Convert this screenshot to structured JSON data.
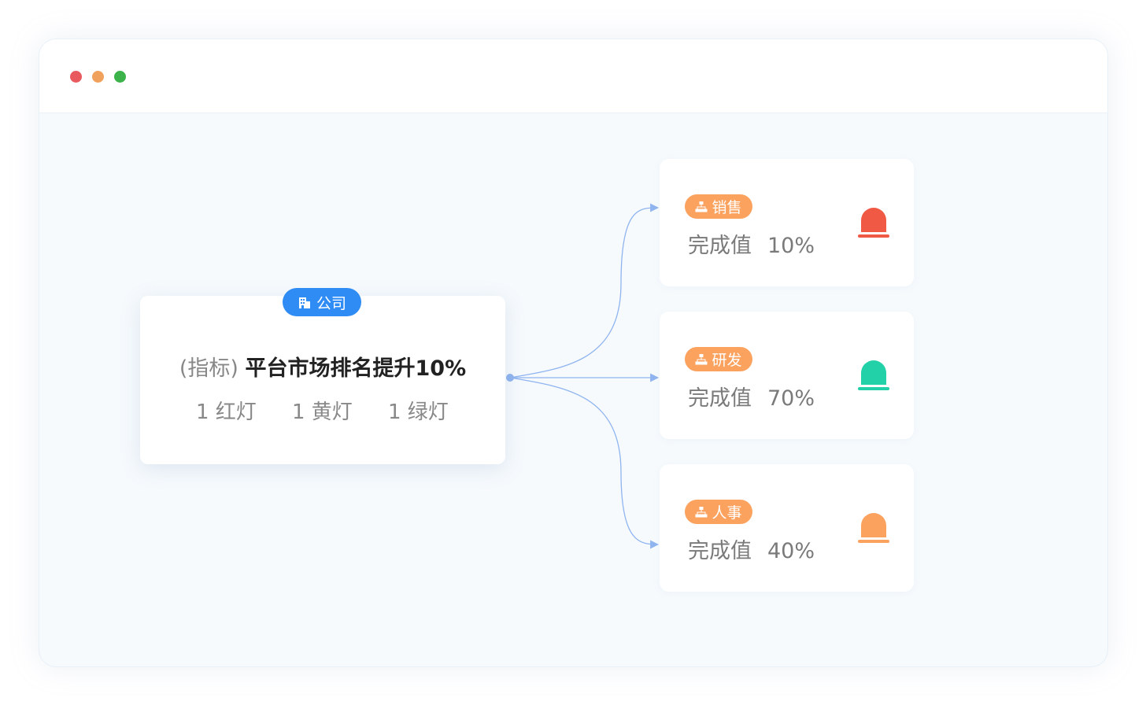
{
  "window": {
    "controls": [
      "close-dot",
      "minimize-dot",
      "maximize-dot"
    ],
    "colors": {
      "close": "#e95a5f",
      "minimize": "#f0a15c",
      "maximize": "#3bb34a"
    }
  },
  "diagram": {
    "root": {
      "tag": "公司",
      "tag_icon": "building-icon",
      "tag_color": "#2f8cf5",
      "prefix": "(指标)",
      "title": "平台市场排名提升10%",
      "lights": [
        {
          "label": "1 红灯"
        },
        {
          "label": "1 黄灯"
        },
        {
          "label": "1 绿灯"
        }
      ]
    },
    "departments": [
      {
        "tag": "销售",
        "value_label": "完成值",
        "value": "10%",
        "lamp_color": "#f05a45",
        "lamp": "red"
      },
      {
        "tag": "研发",
        "value_label": "完成值",
        "value": "70%",
        "lamp_color": "#22d1a7",
        "lamp": "green"
      },
      {
        "tag": "人事",
        "value_label": "完成值",
        "value": "40%",
        "lamp_color": "#fba25f",
        "lamp": "yellow"
      }
    ],
    "dept_tag_icon": "org-chart-icon",
    "dept_tag_color": "#fba25f",
    "connector_color": "#8fb4ef"
  }
}
